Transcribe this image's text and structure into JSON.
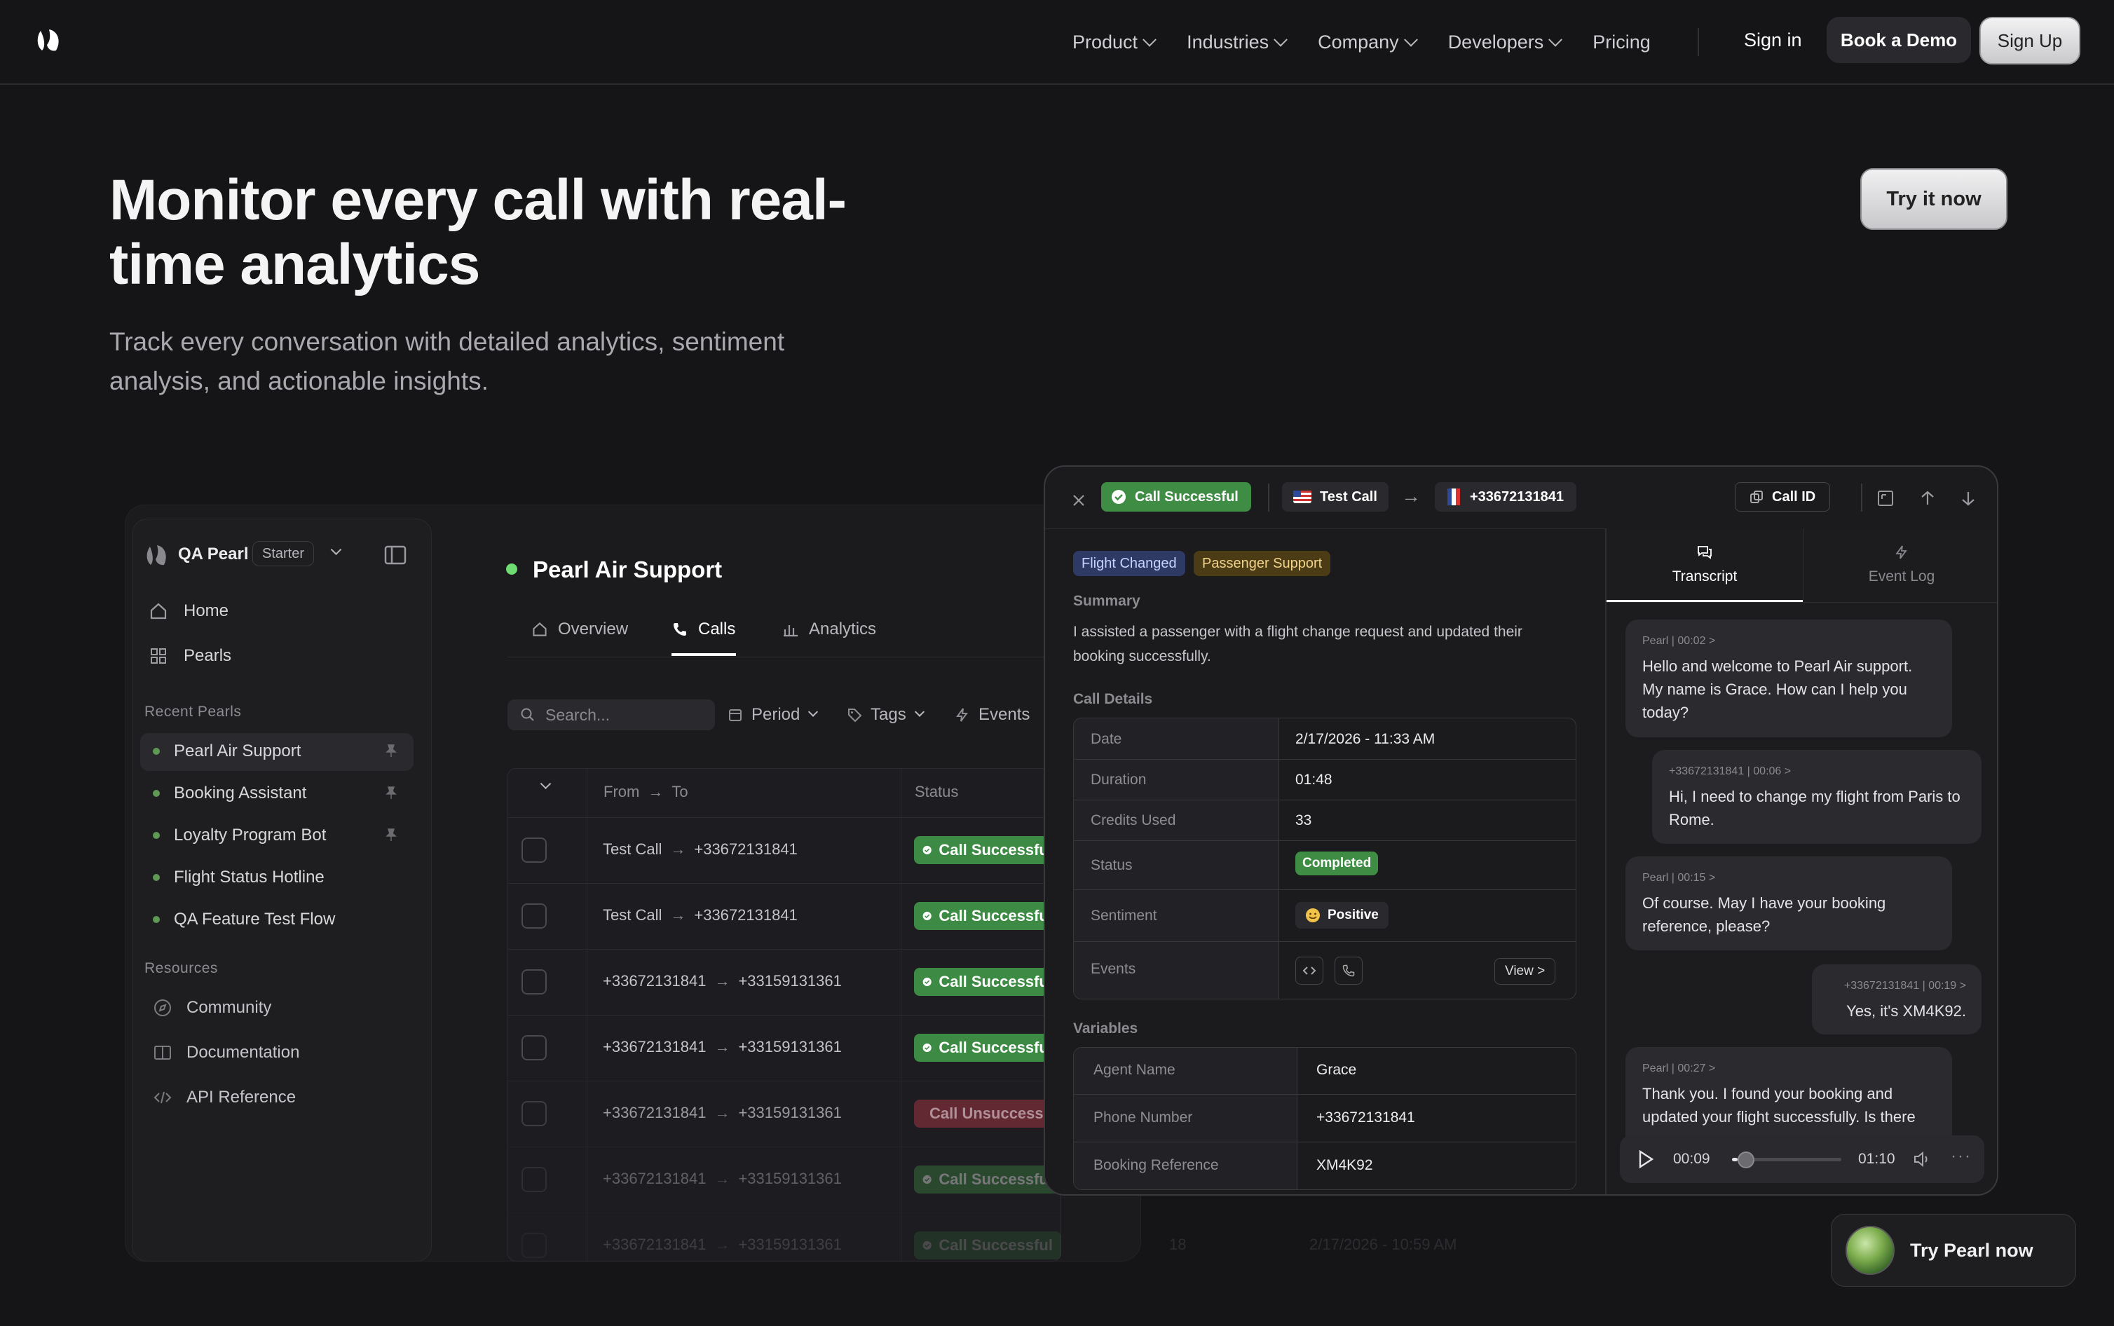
{
  "nav": {
    "items": [
      {
        "label": "Product"
      },
      {
        "label": "Industries"
      },
      {
        "label": "Company"
      },
      {
        "label": "Developers"
      },
      {
        "label": "Pricing"
      }
    ],
    "sign_in": "Sign in",
    "book_demo": "Book a Demo",
    "sign_up": "Sign Up"
  },
  "hero": {
    "title": "Monitor every call with real-time analytics",
    "subtitle": "Track every conversation with detailed analytics, sentiment analysis, and actionable insights.",
    "cta": "Try it now"
  },
  "sidebar": {
    "workspace": "QA Pearl",
    "plan": "Starter",
    "main_items": [
      {
        "label": "Home",
        "icon": "home-icon"
      },
      {
        "label": "Pearls",
        "icon": "grid-icon"
      }
    ],
    "recent_heading": "Recent Pearls",
    "recent": [
      {
        "label": "Pearl Air Support",
        "pinned": true
      },
      {
        "label": "Booking Assistant",
        "pinned": true
      },
      {
        "label": "Loyalty Program Bot",
        "pinned": true
      },
      {
        "label": "Flight Status Hotline",
        "pinned": false
      },
      {
        "label": "QA Feature Test Flow",
        "pinned": false
      }
    ],
    "resources_heading": "Resources",
    "resources": [
      {
        "label": "Community",
        "icon": "compass-icon"
      },
      {
        "label": "Documentation",
        "icon": "book-icon"
      },
      {
        "label": "API Reference",
        "icon": "code-icon"
      }
    ]
  },
  "main": {
    "title": "Pearl Air Support",
    "tabs": [
      {
        "label": "Overview",
        "icon": "home-icon"
      },
      {
        "label": "Calls",
        "icon": "phone-icon",
        "active": true
      },
      {
        "label": "Analytics",
        "icon": "chart-icon"
      }
    ],
    "search_placeholder": "Search...",
    "filters": [
      {
        "label": "Period"
      },
      {
        "label": "Tags"
      },
      {
        "label": "Events"
      }
    ],
    "table": {
      "col_from": "From",
      "col_to": "To",
      "col_status": "Status",
      "rows": [
        {
          "from": "Test Call",
          "to": "+33672131841",
          "status": "Call Successful",
          "ok": true
        },
        {
          "from": "Test Call",
          "to": "+33672131841",
          "status": "Call Successful",
          "ok": true
        },
        {
          "from": "+33672131841",
          "to": "+33159131361",
          "status": "Call Successful",
          "ok": true
        },
        {
          "from": "+33672131841",
          "to": "+33159131361",
          "status": "Call Successful",
          "ok": true
        },
        {
          "from": "+33672131841",
          "to": "+33159131361",
          "status": "Call Unsuccessful",
          "ok": false
        },
        {
          "from": "+33672131841",
          "to": "+33159131361",
          "status": "Call Successful",
          "ok": true
        },
        {
          "from": "+33672131841",
          "to": "+33159131361",
          "status": "Call Successful",
          "ok": true,
          "credits": "18",
          "date": "2/17/2026 - 10:59 AM"
        }
      ]
    }
  },
  "modal": {
    "status": "Call Successful",
    "from": "Test Call",
    "to": "+33672131841",
    "call_id": "Call ID",
    "tags": [
      "Flight Changed",
      "Passenger Support"
    ],
    "summary_heading": "Summary",
    "summary": "I assisted a passenger with a flight change request and updated their booking successfully.",
    "details_heading": "Call Details",
    "details": [
      {
        "label": "Date",
        "value": "2/17/2026 - 11:33 AM"
      },
      {
        "label": "Duration",
        "value": "01:48"
      },
      {
        "label": "Credits Used",
        "value": "33"
      },
      {
        "label": "Status",
        "value": "Completed"
      },
      {
        "label": "Sentiment",
        "value": "Positive"
      },
      {
        "label": "Events",
        "value": "View >"
      }
    ],
    "variables_heading": "Variables",
    "variables": [
      {
        "label": "Agent Name",
        "value": "Grace"
      },
      {
        "label": "Phone Number",
        "value": "+33672131841"
      },
      {
        "label": "Booking Reference",
        "value": "XM4K92"
      }
    ],
    "tabs": [
      {
        "label": "Transcript",
        "active": true
      },
      {
        "label": "Event Log"
      }
    ],
    "transcript": [
      {
        "meta": "Pearl | 00:02 >",
        "text": "Hello and welcome to Pearl Air support. My name is Grace. How can I help you today?",
        "agent": true
      },
      {
        "meta": "+33672131841 | 00:06 >",
        "text": "Hi, I need to change my flight from Paris to Rome.",
        "agent": false
      },
      {
        "meta": "Pearl | 00:15 >",
        "text": "Of course. May I have your booking reference, please?",
        "agent": true
      },
      {
        "meta": "+33672131841 | 00:19 >",
        "text": "Yes, it's XM4K92.",
        "agent": false
      },
      {
        "meta": "Pearl | 00:27 >",
        "text": "Thank you. I found your booking and updated your flight successfully. Is there",
        "agent": true
      }
    ],
    "player": {
      "current": "00:09",
      "total": "01:10",
      "progress": 0.05
    }
  },
  "chat_widget": {
    "label": "Try Pearl now"
  },
  "colors": {
    "bg": "#151417",
    "success": "#3d8a45",
    "danger": "#7a2e3a",
    "accent_dot": "#6fdc73"
  }
}
